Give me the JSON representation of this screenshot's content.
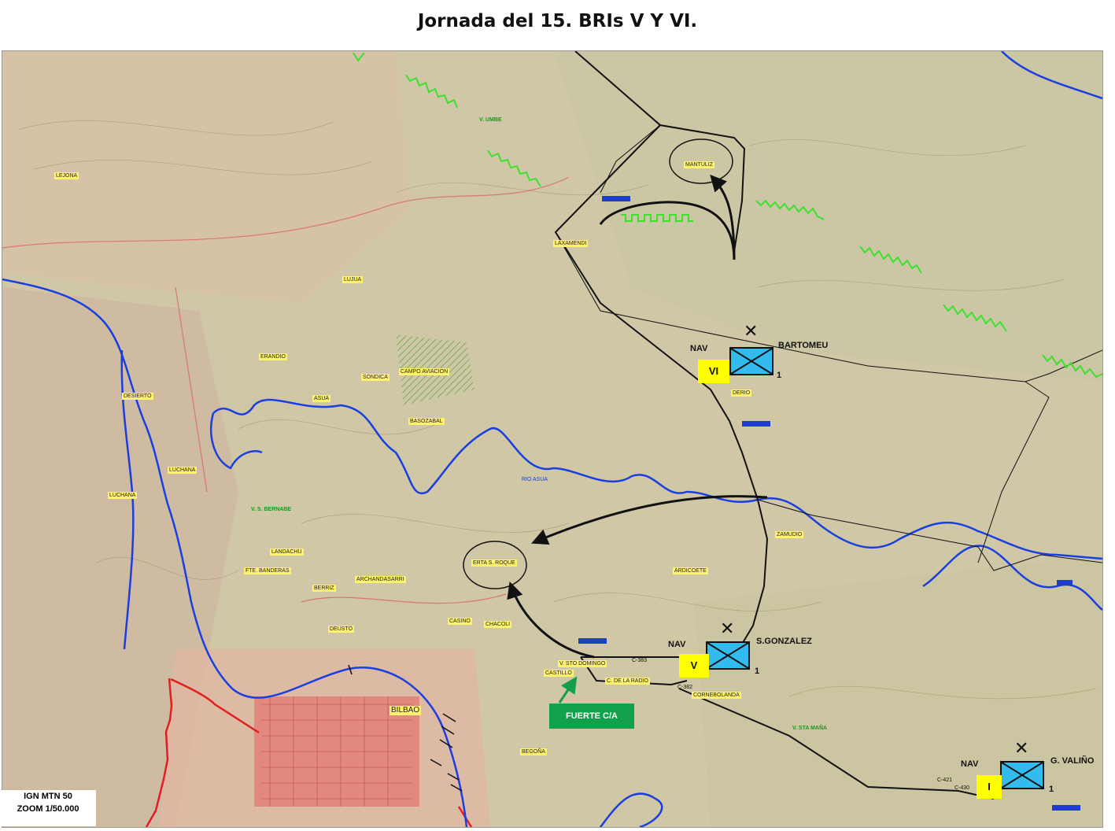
{
  "title": "Jornada del 15. BRIs V Y VI.",
  "places": {
    "lejona": "LEJONA",
    "v_umbe": "V. UMBE",
    "mantuliz": "MANTULIZ",
    "laxamendi": "LAXAMENDI",
    "lujua": "LUJUA",
    "erandio": "ERANDIO",
    "asua": "ASUA",
    "sondica": "SONDICA",
    "campo_aviacion": "CAMPO AVIACION",
    "basozabal": "BASOZABAL",
    "desierto": "DESIERTO",
    "luchana1": "LUCHANA",
    "luchana2": "LUCHANA",
    "v_s_bernabe": "V. S. BERNABE",
    "rio_asua": "RIO ASUA",
    "landachu": "LANDACHU",
    "fte_banderas": "FTE. BANDERAS",
    "berriz": "BERRIZ",
    "archandasarri": "ARCHANDASARRI",
    "deusto": "DEUSTO",
    "casino": "CASINO",
    "chacoli": "CHACOLI",
    "erta_s_roque": "ERTA S. ROQUE",
    "ardicoete": "ARDICOETE",
    "zamudio": "ZAMUDIO",
    "derio": "DERIO",
    "v_sto_domingo": "V. STO DOMINGO",
    "castillo": "CASTILLO",
    "c383": "C-383",
    "c_de_la_radio": "C. DE LA RADIO",
    "c382": "C-382",
    "cornebolanda": "CORNEBOLANDA",
    "v_sta_mana": "V. STA MAÑA",
    "bilbao": "BILBAO",
    "begona": "BEGOÑA",
    "c421": "C-421",
    "c430": "C-430"
  },
  "units": [
    {
      "id": "VI",
      "prefix": "NAV",
      "commander": "BARTOMEU",
      "suffix": "1"
    },
    {
      "id": "V",
      "prefix": "NAV",
      "commander": "S.GONZALEZ",
      "suffix": "1"
    },
    {
      "id": "I",
      "prefix": "NAV",
      "commander": "G. VALIÑO",
      "suffix": "1"
    }
  ],
  "callouts": {
    "fuerte": "FUERTE C/A"
  },
  "source": {
    "line1": "IGN MTN 50",
    "line2": "ZOOM 1/50.000"
  },
  "colors": {
    "river": "#1a3fe0",
    "front_green": "#3ee030",
    "unit_fill": "#33bbee",
    "unit_label": "#ffff00",
    "callout": "#12a04a",
    "road_red": "#e02020"
  }
}
